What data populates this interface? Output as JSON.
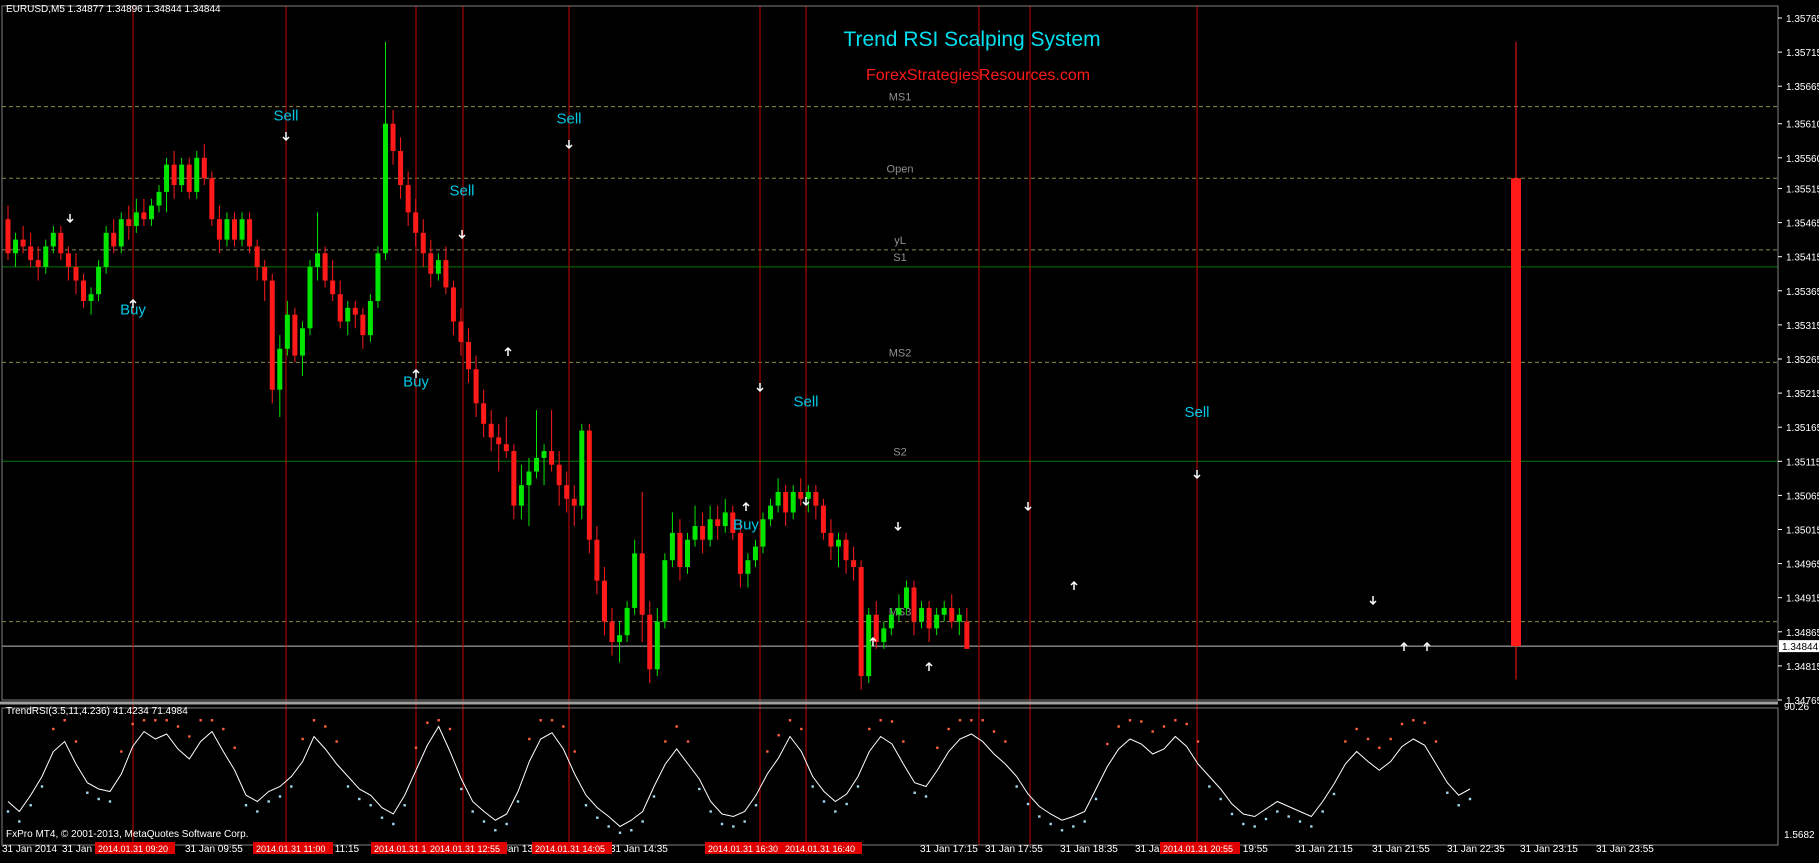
{
  "header": {
    "symbol_info": "EURUSD,M5  1.34877 1.34896 1.34844 1.34844"
  },
  "title": "Trend RSI Scalping System",
  "subtitle": "ForexStrategiesResources.com",
  "copyright": "FxPro MT4, © 2001-2013, MetaQuotes Software Corp.",
  "colors": {
    "background": "#000000",
    "bull": "#00e600",
    "bear": "#ff1a1a",
    "title": "#00e0f0",
    "subtitle": "#ff1a1a",
    "signal_text": "#00c8e6",
    "vline": "#c80000",
    "pivot_dashed": "#8a8a4a",
    "support_line": "#007a00",
    "rsi_line": "#ffffff",
    "rsi_dots_high": "#ff6040",
    "rsi_dots_low": "#a0d8f0"
  },
  "chart_data": {
    "type": "candlestick",
    "instrument": "EURUSD,M5",
    "ohlc": {
      "open": 1.34877,
      "high": 1.34896,
      "low": 1.34844,
      "close": 1.34844
    },
    "current_price_label": "1.34844",
    "ylim": [
      1.34765,
      1.35765
    ],
    "y_ticks": [
      "1.35765",
      "1.35715",
      "1.35665",
      "1.35610",
      "1.35560",
      "1.35515",
      "1.35465",
      "1.35415",
      "1.35365",
      "1.35315",
      "1.35265",
      "1.35215",
      "1.35165",
      "1.35115",
      "1.35065",
      "1.35015",
      "1.34965",
      "1.34915",
      "1.34865",
      "1.34815",
      "1.34765"
    ],
    "time_labels": [
      "31 Jan 2014",
      "31 Jan",
      "31 Jan 09:55",
      "31 Jan 11:15",
      "Jan 13",
      "31 Jan 14:35",
      "31 Jan",
      "31 Jan 17:15",
      "31 Jan 17:55",
      "31 Jan 18:35",
      "31 Jan 19:15",
      "31 Jan 19:55",
      "31 Jan 21:15",
      "31 Jan 21:55",
      "31 Jan 22:35",
      "31 Jan 23:15",
      "31 Jan 23:55"
    ],
    "highlighted_time_labels": [
      "2014.01.31 09:20",
      "2014.01.31 11:00",
      "2014.01.31 12:20",
      "2014.01.31 12:55",
      "2014.01.31 14:05",
      "2014.01.31 16:30",
      "2014.01.31 16:40",
      "2014.01.31 20:55"
    ],
    "pivot_levels": [
      {
        "label": "MS1",
        "price": 1.35635,
        "style": "dashed"
      },
      {
        "label": "Open",
        "price": 1.3553,
        "style": "dashed"
      },
      {
        "label": "yL",
        "price": 1.35425,
        "style": "dashed"
      },
      {
        "label": "S1",
        "price": 1.354,
        "style": "solid"
      },
      {
        "label": "MS2",
        "price": 1.3526,
        "style": "dashed"
      },
      {
        "label": "S2",
        "price": 1.35115,
        "style": "solid"
      },
      {
        "label": "MS3",
        "price": 1.3488,
        "style": "dashed"
      }
    ],
    "signals": [
      {
        "label": "Buy",
        "price": 1.3533
      },
      {
        "label": "Sell",
        "price": 1.35615
      },
      {
        "label": "Sell",
        "price": 1.35505
      },
      {
        "label": "Buy",
        "price": 1.35225
      },
      {
        "label": "Sell",
        "price": 1.3561
      },
      {
        "label": "Sell",
        "price": 1.35195
      },
      {
        "label": "Buy",
        "price": 1.35015
      },
      {
        "label": "Sell",
        "price": 1.3518
      }
    ],
    "candles": [
      [
        1.3547,
        1.3549,
        1.3541,
        1.3542
      ],
      [
        1.3542,
        1.3545,
        1.354,
        1.3544
      ],
      [
        1.3544,
        1.3546,
        1.3542,
        1.3543
      ],
      [
        1.3543,
        1.3545,
        1.354,
        1.3541
      ],
      [
        1.3541,
        1.3543,
        1.3538,
        1.354
      ],
      [
        1.354,
        1.3544,
        1.3539,
        1.3543
      ],
      [
        1.3543,
        1.3546,
        1.3542,
        1.3545
      ],
      [
        1.3545,
        1.3546,
        1.3541,
        1.3542
      ],
      [
        1.3542,
        1.3543,
        1.3538,
        1.354
      ],
      [
        1.354,
        1.3542,
        1.3536,
        1.3538
      ],
      [
        1.3538,
        1.3539,
        1.3534,
        1.3535
      ],
      [
        1.3535,
        1.3537,
        1.3533,
        1.3536
      ],
      [
        1.3536,
        1.3541,
        1.3535,
        1.354
      ],
      [
        1.354,
        1.3546,
        1.3539,
        1.3545
      ],
      [
        1.3545,
        1.3547,
        1.3542,
        1.3543
      ],
      [
        1.3543,
        1.3548,
        1.3542,
        1.3547
      ],
      [
        1.3547,
        1.3549,
        1.3544,
        1.3546
      ],
      [
        1.3546,
        1.355,
        1.3545,
        1.3548
      ],
      [
        1.3548,
        1.355,
        1.3546,
        1.3547
      ],
      [
        1.3547,
        1.355,
        1.3546,
        1.3549
      ],
      [
        1.3549,
        1.3552,
        1.3548,
        1.3551
      ],
      [
        1.3551,
        1.3556,
        1.3548,
        1.3555
      ],
      [
        1.3555,
        1.3557,
        1.355,
        1.3552
      ],
      [
        1.3552,
        1.3556,
        1.3551,
        1.3555
      ],
      [
        1.3555,
        1.3556,
        1.355,
        1.3551
      ],
      [
        1.3551,
        1.3557,
        1.355,
        1.3556
      ],
      [
        1.3556,
        1.3558,
        1.3552,
        1.3553
      ],
      [
        1.3553,
        1.3554,
        1.3546,
        1.3547
      ],
      [
        1.3547,
        1.3549,
        1.3542,
        1.3544
      ],
      [
        1.3544,
        1.3548,
        1.3543,
        1.3547
      ],
      [
        1.3547,
        1.3548,
        1.3543,
        1.3544
      ],
      [
        1.3544,
        1.3548,
        1.3543,
        1.3547
      ],
      [
        1.3547,
        1.3548,
        1.3542,
        1.3543
      ],
      [
        1.3543,
        1.3544,
        1.3538,
        1.354
      ],
      [
        1.354,
        1.3541,
        1.3535,
        1.3538
      ],
      [
        1.3538,
        1.3539,
        1.352,
        1.3522
      ],
      [
        1.3522,
        1.353,
        1.3518,
        1.3528
      ],
      [
        1.3528,
        1.3535,
        1.3527,
        1.3533
      ],
      [
        1.3533,
        1.3534,
        1.3526,
        1.3527
      ],
      [
        1.3527,
        1.3532,
        1.3524,
        1.3531
      ],
      [
        1.3531,
        1.3541,
        1.353,
        1.354
      ],
      [
        1.354,
        1.3548,
        1.3538,
        1.3542
      ],
      [
        1.3542,
        1.3543,
        1.3537,
        1.3538
      ],
      [
        1.3538,
        1.3541,
        1.3535,
        1.3536
      ],
      [
        1.3536,
        1.3538,
        1.3531,
        1.3532
      ],
      [
        1.3532,
        1.3535,
        1.353,
        1.3534
      ],
      [
        1.3534,
        1.3535,
        1.3531,
        1.3533
      ],
      [
        1.3533,
        1.3534,
        1.3528,
        1.353
      ],
      [
        1.353,
        1.3536,
        1.3529,
        1.3535
      ],
      [
        1.3535,
        1.3543,
        1.3534,
        1.3542
      ],
      [
        1.3542,
        1.3573,
        1.3541,
        1.3561
      ],
      [
        1.3561,
        1.3563,
        1.3555,
        1.3557
      ],
      [
        1.3557,
        1.3559,
        1.355,
        1.3552
      ],
      [
        1.3552,
        1.3554,
        1.3546,
        1.3548
      ],
      [
        1.3548,
        1.355,
        1.3543,
        1.3545
      ],
      [
        1.3545,
        1.3547,
        1.354,
        1.3542
      ],
      [
        1.3542,
        1.3544,
        1.3537,
        1.3539
      ],
      [
        1.3539,
        1.3542,
        1.3538,
        1.3541
      ],
      [
        1.3541,
        1.3543,
        1.3536,
        1.3537
      ],
      [
        1.3537,
        1.3538,
        1.353,
        1.3532
      ],
      [
        1.3532,
        1.3534,
        1.3527,
        1.3529
      ],
      [
        1.3529,
        1.3531,
        1.3523,
        1.3525
      ],
      [
        1.3525,
        1.3527,
        1.3518,
        1.352
      ],
      [
        1.352,
        1.3522,
        1.3515,
        1.3517
      ],
      [
        1.3517,
        1.3519,
        1.3513,
        1.3515
      ],
      [
        1.3515,
        1.3517,
        1.351,
        1.3514
      ],
      [
        1.3514,
        1.3518,
        1.3512,
        1.3513
      ],
      [
        1.3513,
        1.3514,
        1.3503,
        1.3505
      ],
      [
        1.3505,
        1.3511,
        1.3503,
        1.3508
      ],
      [
        1.3508,
        1.3512,
        1.3502,
        1.351
      ],
      [
        1.351,
        1.3519,
        1.3509,
        1.3512
      ],
      [
        1.3512,
        1.3514,
        1.3508,
        1.3513
      ],
      [
        1.3513,
        1.3519,
        1.351,
        1.3511
      ],
      [
        1.3511,
        1.3513,
        1.3505,
        1.3508
      ],
      [
        1.3508,
        1.351,
        1.3504,
        1.3506
      ],
      [
        1.3506,
        1.3508,
        1.3502,
        1.3505
      ],
      [
        1.3505,
        1.3517,
        1.3503,
        1.3516
      ],
      [
        1.3516,
        1.3517,
        1.3498,
        1.35
      ],
      [
        1.35,
        1.3502,
        1.3492,
        1.3494
      ],
      [
        1.3494,
        1.3496,
        1.3486,
        1.3488
      ],
      [
        1.3488,
        1.349,
        1.3483,
        1.3485
      ],
      [
        1.3485,
        1.3488,
        1.3482,
        1.3486
      ],
      [
        1.3486,
        1.3491,
        1.3485,
        1.349
      ],
      [
        1.349,
        1.35,
        1.3489,
        1.3498
      ],
      [
        1.3498,
        1.3507,
        1.3485,
        1.3489
      ],
      [
        1.3489,
        1.3491,
        1.3479,
        1.3481
      ],
      [
        1.3481,
        1.349,
        1.348,
        1.3488
      ],
      [
        1.3488,
        1.3498,
        1.3487,
        1.3497
      ],
      [
        1.3497,
        1.3504,
        1.3496,
        1.3501
      ],
      [
        1.3501,
        1.3503,
        1.3494,
        1.3496
      ],
      [
        1.3496,
        1.3501,
        1.3495,
        1.35
      ],
      [
        1.35,
        1.3505,
        1.3499,
        1.3502
      ],
      [
        1.3502,
        1.3504,
        1.3498,
        1.35
      ],
      [
        1.35,
        1.3505,
        1.3499,
        1.3503
      ],
      [
        1.3503,
        1.3505,
        1.35,
        1.3502
      ],
      [
        1.3502,
        1.3506,
        1.3501,
        1.3504
      ],
      [
        1.3504,
        1.3505,
        1.35,
        1.3501
      ],
      [
        1.3501,
        1.3503,
        1.3493,
        1.3495
      ],
      [
        1.3495,
        1.3498,
        1.3493,
        1.3497
      ],
      [
        1.3497,
        1.35,
        1.3496,
        1.3499
      ],
      [
        1.3499,
        1.3504,
        1.3498,
        1.3503
      ],
      [
        1.3503,
        1.3506,
        1.3502,
        1.3505
      ],
      [
        1.3505,
        1.3509,
        1.3504,
        1.3507
      ],
      [
        1.3507,
        1.3508,
        1.3502,
        1.3504
      ],
      [
        1.3504,
        1.3508,
        1.3503,
        1.3507
      ],
      [
        1.3507,
        1.3509,
        1.3505,
        1.3506
      ],
      [
        1.3506,
        1.3508,
        1.3504,
        1.3507
      ],
      [
        1.3507,
        1.3508,
        1.3503,
        1.3505
      ],
      [
        1.3505,
        1.3506,
        1.35,
        1.3501
      ],
      [
        1.3501,
        1.3503,
        1.3497,
        1.3499
      ],
      [
        1.3499,
        1.3501,
        1.3496,
        1.35
      ],
      [
        1.35,
        1.3501,
        1.3495,
        1.3497
      ],
      [
        1.3497,
        1.3499,
        1.3494,
        1.3496
      ],
      [
        1.3496,
        1.3497,
        1.3478,
        1.348
      ],
      [
        1.348,
        1.349,
        1.3479,
        1.3489
      ],
      [
        1.3489,
        1.3491,
        1.3484,
        1.3485
      ],
      [
        1.3485,
        1.3488,
        1.3484,
        1.3487
      ],
      [
        1.3487,
        1.349,
        1.3486,
        1.3489
      ],
      [
        1.3489,
        1.3492,
        1.3488,
        1.349
      ],
      [
        1.349,
        1.3494,
        1.3489,
        1.3493
      ],
      [
        1.3493,
        1.3494,
        1.3486,
        1.3488
      ],
      [
        1.3488,
        1.3491,
        1.3487,
        1.349
      ],
      [
        1.349,
        1.3491,
        1.3485,
        1.3487
      ],
      [
        1.3487,
        1.349,
        1.3486,
        1.3489
      ],
      [
        1.3489,
        1.3491,
        1.3488,
        1.349
      ],
      [
        1.349,
        1.3492,
        1.3487,
        1.3488
      ],
      [
        1.3488,
        1.349,
        1.3486,
        1.3489
      ],
      [
        1.3488,
        1.349,
        1.3484,
        1.3484
      ]
    ],
    "last_bar": {
      "open": 1.3553,
      "high": 1.3573,
      "low": 1.34795,
      "close": 1.34844
    },
    "rsi": {
      "label": "TrendRSI(3.5,11,4.236) 41.4234 71.4984",
      "ylim": [
        1.5682,
        90.26
      ],
      "y_tick_top": "90.26",
      "y_tick_bottom": "1.5682",
      "values": [
        30,
        22,
        35,
        50,
        70,
        78,
        60,
        45,
        40,
        38,
        52,
        74,
        86,
        80,
        84,
        72,
        64,
        78,
        86,
        70,
        55,
        35,
        30,
        38,
        42,
        50,
        62,
        82,
        72,
        60,
        50,
        40,
        35,
        25,
        20,
        35,
        55,
        75,
        90,
        70,
        48,
        30,
        22,
        15,
        20,
        38,
        62,
        80,
        85,
        72,
        52,
        35,
        25,
        18,
        10,
        15,
        22,
        42,
        60,
        72,
        60,
        48,
        30,
        20,
        18,
        22,
        35,
        52,
        65,
        82,
        70,
        50,
        38,
        30,
        36,
        50,
        70,
        82,
        76,
        60,
        45,
        42,
        55,
        70,
        80,
        84,
        78,
        68,
        60,
        50,
        36,
        26,
        20,
        15,
        18,
        22,
        40,
        58,
        72,
        80,
        76,
        68,
        72,
        82,
        74,
        60,
        50,
        40,
        28,
        20,
        18,
        24,
        30,
        26,
        22,
        18,
        30,
        44,
        60,
        70,
        62,
        55,
        62,
        74,
        80,
        75,
        60,
        45,
        35,
        40
      ]
    },
    "vlines_index": [
      9,
      19,
      28,
      32,
      39,
      51,
      55,
      69,
      73,
      113
    ]
  }
}
